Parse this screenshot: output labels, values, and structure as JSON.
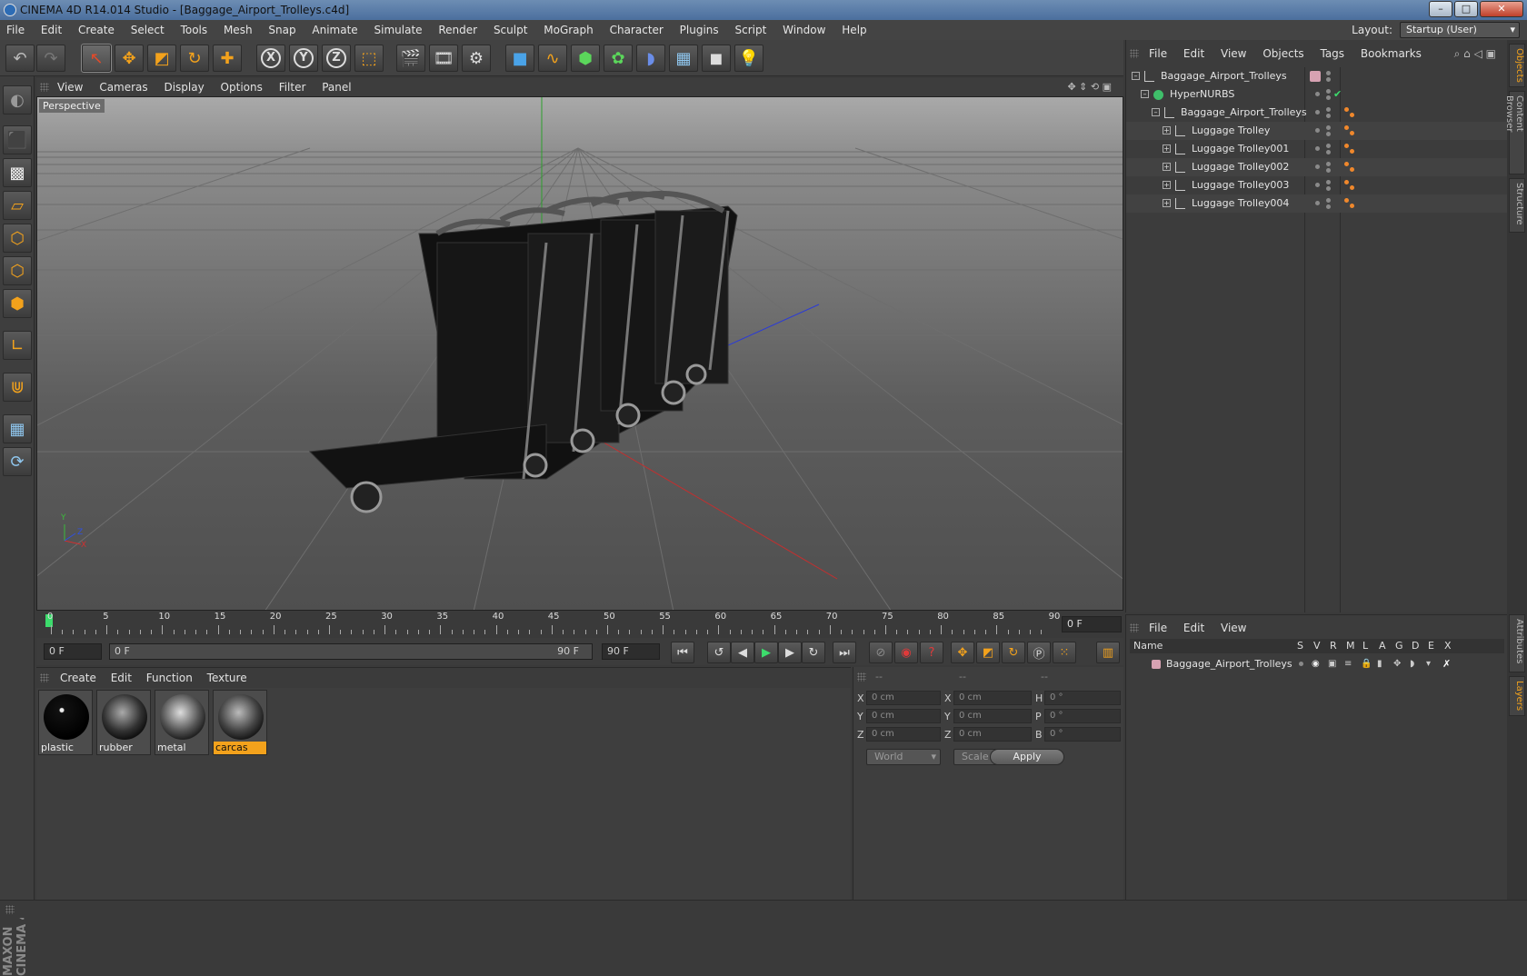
{
  "window": {
    "title": "CINEMA 4D R14.014 Studio - [Baggage_Airport_Trolleys.c4d]",
    "min_label": "–",
    "max_label": "□",
    "close_label": "✕"
  },
  "menubar": {
    "items": [
      "File",
      "Edit",
      "Create",
      "Select",
      "Tools",
      "Mesh",
      "Snap",
      "Animate",
      "Simulate",
      "Render",
      "Sculpt",
      "MoGraph",
      "Character",
      "Plugins",
      "Script",
      "Window",
      "Help"
    ],
    "layout_label": "Layout:",
    "layout_value": "Startup (User)"
  },
  "toolbar": {
    "icons": [
      "undo-icon",
      "redo-icon",
      "live-selection-icon",
      "move-icon",
      "scale-icon",
      "rotate-icon",
      "add-icon",
      "x-axis-icon",
      "y-axis-icon",
      "z-axis-icon",
      "coordinate-system-icon",
      "render-view-icon",
      "render-picture-viewer-icon",
      "render-settings-icon",
      "cube-icon",
      "spline-icon",
      "nurbs-icon",
      "array-icon",
      "deformer-icon",
      "floor-icon",
      "camera-icon",
      "light-icon"
    ],
    "axis_labels": {
      "x": "X",
      "y": "Y",
      "z": "Z"
    }
  },
  "viewport": {
    "menu": [
      "View",
      "Cameras",
      "Display",
      "Options",
      "Filter",
      "Panel"
    ],
    "label": "Perspective",
    "axis_y": "Y",
    "axis_z": "Z",
    "axis_x": "X"
  },
  "timeline": {
    "ticks": [
      "0",
      "5",
      "10",
      "15",
      "20",
      "25",
      "30",
      "35",
      "40",
      "45",
      "50",
      "55",
      "60",
      "65",
      "70",
      "75",
      "80",
      "85",
      "90"
    ],
    "current_frame": "0 F"
  },
  "transport": {
    "start_field": "0 F",
    "range_start": "0 F",
    "range_end": "90 F",
    "end_field": "90 F"
  },
  "materials": {
    "menu": [
      "Create",
      "Edit",
      "Function",
      "Texture"
    ],
    "items": [
      {
        "name": "plastic",
        "selected": false
      },
      {
        "name": "rubber",
        "selected": false
      },
      {
        "name": "metal",
        "selected": false
      },
      {
        "name": "carcas",
        "selected": true
      }
    ]
  },
  "coordinates": {
    "headers": [
      "--",
      "--",
      "--"
    ],
    "rows": [
      {
        "l1": "X",
        "v1": "0 cm",
        "l2": "X",
        "v2": "0 cm",
        "l3": "H",
        "v3": "0 °"
      },
      {
        "l1": "Y",
        "v1": "0 cm",
        "l2": "Y",
        "v2": "0 cm",
        "l3": "P",
        "v3": "0 °"
      },
      {
        "l1": "Z",
        "v1": "0 cm",
        "l2": "Z",
        "v2": "0 cm",
        "l3": "B",
        "v3": "0 °"
      }
    ],
    "mode1": "World",
    "mode2": "Scale",
    "apply": "Apply"
  },
  "objects": {
    "menu": [
      "File",
      "Edit",
      "View",
      "Objects",
      "Tags",
      "Bookmarks"
    ],
    "tree": [
      {
        "name": "Baggage_Airport_Trolleys",
        "depth": 0
      },
      {
        "name": "HyperNURBS",
        "depth": 1
      },
      {
        "name": "Baggage_Airport_Trolleys",
        "depth": 2
      },
      {
        "name": "Luggage Trolley",
        "depth": 3
      },
      {
        "name": "Luggage Trolley001",
        "depth": 3
      },
      {
        "name": "Luggage Trolley002",
        "depth": 3
      },
      {
        "name": "Luggage Trolley003",
        "depth": 3
      },
      {
        "name": "Luggage Trolley004",
        "depth": 3
      }
    ]
  },
  "side_tabs": [
    "Objects",
    "Content Browser",
    "Structure",
    "Attributes",
    "Layers"
  ],
  "layers": {
    "menu": [
      "File",
      "Edit",
      "View"
    ],
    "columns": [
      "Name",
      "S",
      "V",
      "R",
      "M",
      "L",
      "A",
      "G",
      "D",
      "E",
      "X"
    ],
    "rows": [
      {
        "name": "Baggage_Airport_Trolleys"
      }
    ]
  },
  "branding": {
    "text": "MAXON CINEMA 4D"
  },
  "colors": {
    "accent": "#f3a21c",
    "active_frame": "#3cdc6c",
    "layer_swatch": "#d7a2b2"
  }
}
